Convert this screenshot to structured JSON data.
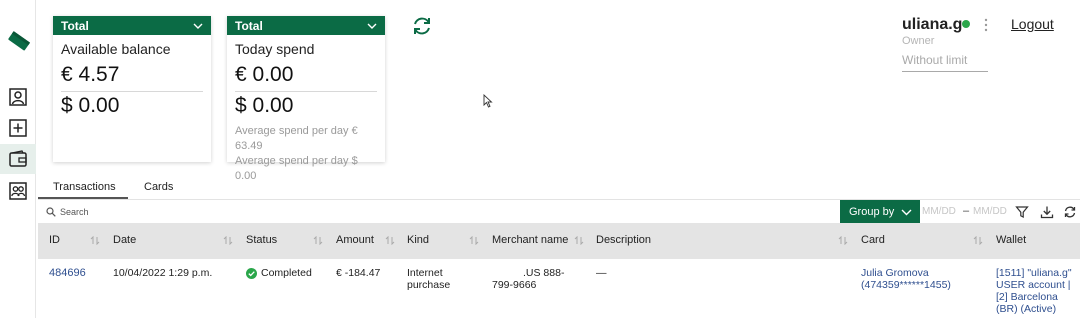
{
  "sidebar": {
    "items": [
      {
        "icon": "ticket-icon"
      },
      {
        "icon": "user-card-icon"
      },
      {
        "icon": "plus-box-icon"
      },
      {
        "icon": "wallet-icon",
        "active": true
      },
      {
        "icon": "users-icon"
      }
    ],
    "active_bg": "#e6efeb"
  },
  "cards": {
    "balance": {
      "header": "Total",
      "label": "Available balance",
      "eur": "€ 4.57",
      "usd": "$ 0.00"
    },
    "spend": {
      "header": "Total",
      "label": "Today spend",
      "eur": "€ 0.00",
      "usd": "$ 0.00",
      "avg_eur": "Average spend per day € 63.49",
      "avg_usd": "Average spend per day $ 0.00"
    },
    "accent": "#0b6b45"
  },
  "user": {
    "name": "uliana.g",
    "status_color": "#2aa64a",
    "role": "Owner",
    "limit": "Without limit",
    "logout_label": "Logout"
  },
  "tabs": [
    {
      "label": "Transactions",
      "active": true
    },
    {
      "label": "Cards",
      "active": false
    }
  ],
  "toolbar": {
    "search_placeholder": "Search",
    "group_by_label": "Group by",
    "date_from_placeholder": "MM/DD",
    "date_separator": "–",
    "date_to_placeholder": "MM/DD"
  },
  "table": {
    "columns": [
      "ID",
      "Date",
      "Status",
      "Amount",
      "Kind",
      "Merchant name",
      "Description",
      "Card",
      "Wallet"
    ],
    "rows": [
      {
        "id": "484696",
        "date": "10/04/2022 1:29 p.m.",
        "status": "Completed",
        "amount": "€ -184.47",
        "kind_1": "Internet",
        "kind_2": "purchase",
        "merchant_1": ".US 888-",
        "merchant_2": "799-9666",
        "description": "—",
        "card_1": "Julia Gromova",
        "card_2": "(474359******1455)",
        "wallet_1": "[1511] \"uliana.g\"",
        "wallet_2": "USER account |",
        "wallet_3": "[2] Barcelona",
        "wallet_4": "(BR) (Active)"
      }
    ]
  }
}
